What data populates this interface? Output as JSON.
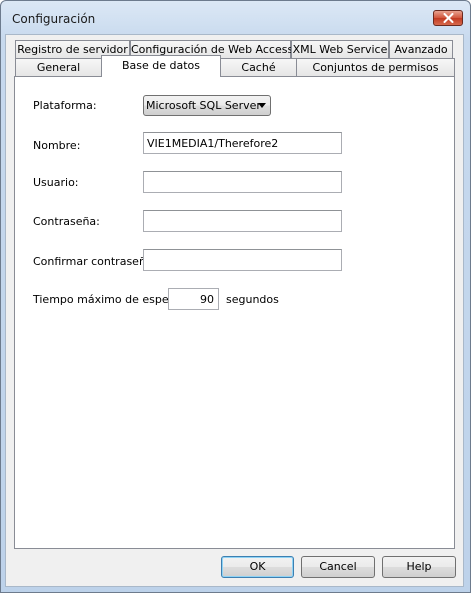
{
  "window": {
    "title": "Configuración"
  },
  "tabs": {
    "row_top": [
      {
        "label": "Registro de servidor"
      },
      {
        "label": "Configuración de Web Access"
      },
      {
        "label": "XML Web Service"
      },
      {
        "label": "Avanzado"
      }
    ],
    "row_bottom": [
      {
        "label": "General"
      },
      {
        "label": "Base de datos",
        "active": true
      },
      {
        "label": "Caché"
      },
      {
        "label": "Conjuntos de permisos"
      }
    ]
  },
  "form": {
    "platform": {
      "label": "Plataforma:",
      "value": "Microsoft SQL Server"
    },
    "name": {
      "label": "Nombre:",
      "value": "VIE1MEDIA1/Therefore2"
    },
    "user": {
      "label": "Usuario:",
      "value": ""
    },
    "password": {
      "label": "Contraseña:",
      "value": ""
    },
    "confirm_password": {
      "label": "Confirmar contraseña:",
      "value": ""
    },
    "timeout": {
      "label": "Tiempo máximo de espera:",
      "value": "90",
      "unit": "segundos"
    }
  },
  "buttons": {
    "ok": "OK",
    "cancel": "Cancel",
    "help": "Help"
  },
  "icons": {
    "close": "close-icon",
    "dropdown": "chevron-down-icon"
  }
}
